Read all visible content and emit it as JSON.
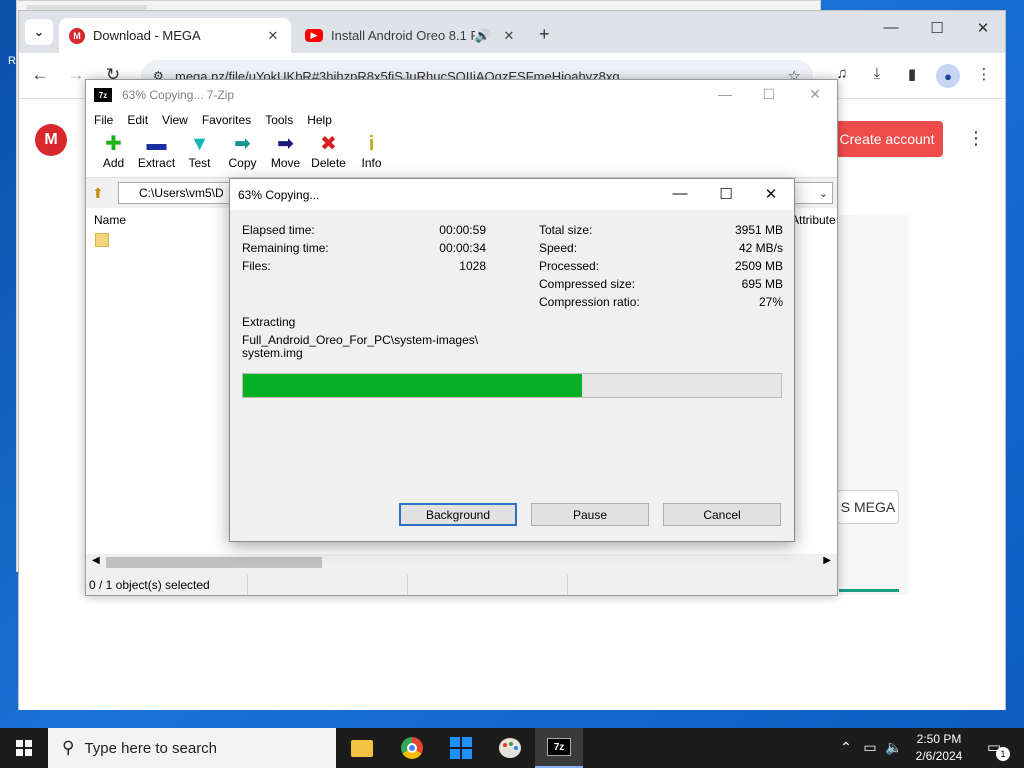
{
  "desktop": {
    "left_label": "R"
  },
  "browser": {
    "tabs": [
      {
        "title": "Download - MEGA",
        "favicon": "M",
        "active": true
      },
      {
        "title": "Install Android Oreo 8.1 Po",
        "active": false,
        "audio": true
      }
    ],
    "menu_glyph": "⌄",
    "close_glyph": "✕",
    "new_tab_glyph": "+",
    "window_controls": {
      "minimize": "—",
      "maximize": "☐",
      "close": "✕"
    },
    "nav": {
      "back": "←",
      "forward": "→",
      "reload": "↻"
    },
    "url": "mega.nz/file/uYokUKbR#3hihzpR8x5fiSJuRhucSQIIiAOgzESFmeHioahyz8xg",
    "page": {
      "logo": "M",
      "create_account": "Create account",
      "mega_button": "S MEGA"
    }
  },
  "sevenzip": {
    "title": "63% Copying... 7-Zip",
    "logo": "7z",
    "menu": [
      "File",
      "Edit",
      "View",
      "Favorites",
      "Tools",
      "Help"
    ],
    "tools": [
      {
        "label": "Add",
        "glyph": "✚"
      },
      {
        "label": "Extract",
        "glyph": "▬"
      },
      {
        "label": "Test",
        "glyph": "▼"
      },
      {
        "label": "Copy",
        "glyph": "➡"
      },
      {
        "label": "Move",
        "glyph": "➡"
      },
      {
        "label": "Delete",
        "glyph": "✖"
      },
      {
        "label": "Info",
        "glyph": "i"
      }
    ],
    "path": "C:\\Users\\vm5\\D",
    "columns": {
      "name": "Name",
      "attributes": "Attribute"
    },
    "status": "0 / 1 object(s) selected"
  },
  "dialog": {
    "title": "63% Copying...",
    "left_stats": [
      {
        "label": "Elapsed time:",
        "value": "00:00:59"
      },
      {
        "label": "Remaining time:",
        "value": "00:00:34"
      },
      {
        "label": "Files:",
        "value": "1028"
      }
    ],
    "right_stats": [
      {
        "label": "Total size:",
        "value": "3951 MB"
      },
      {
        "label": "Speed:",
        "value": "42 MB/s"
      },
      {
        "label": "Processed:",
        "value": "2509 MB"
      },
      {
        "label": "Compressed size:",
        "value": "695 MB"
      },
      {
        "label": "Compression ratio:",
        "value": "27%"
      }
    ],
    "action": "Extracting",
    "file_line1": "Full_Android_Oreo_For_PC\\system-images\\",
    "file_line2": "system.img",
    "progress": 0.63,
    "buttons": {
      "background": "Background",
      "pause": "Pause",
      "cancel": "Cancel"
    }
  },
  "taskbar": {
    "search_placeholder": "Type here to search",
    "time": "2:50 PM",
    "date": "2/6/2024",
    "notification_count": "1",
    "app_7z": "7z"
  },
  "colors": {
    "progress_fill": "#06b025",
    "mega_red": "#d9272e",
    "create_button": "#f04b4b",
    "taskbar": "#1c1c1c"
  }
}
